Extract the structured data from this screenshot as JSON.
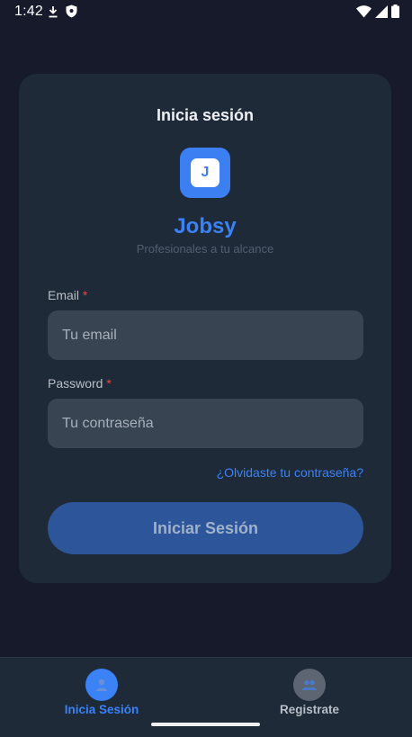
{
  "status_bar": {
    "time": "1:42",
    "icons": [
      "download-icon",
      "shield-icon",
      "wifi-icon",
      "signal-icon",
      "battery-icon"
    ]
  },
  "login_card": {
    "title": "Inicia sesión",
    "logo_letter": "J",
    "brand_name": "Jobsy",
    "tagline": "Profesionales a tu alcance",
    "email": {
      "label": "Email",
      "required_mark": "*",
      "placeholder": "Tu email",
      "value": ""
    },
    "password": {
      "label": "Password",
      "required_mark": "*",
      "placeholder": "Tu contraseña",
      "value": ""
    },
    "forgot_password": "¿Olvidaste tu contraseña?",
    "submit_label": "Iniciar Sesión"
  },
  "bottom_nav": {
    "items": [
      {
        "label": "Inicia Sesión",
        "icon": "user-icon",
        "active": true
      },
      {
        "label": "Registrate",
        "icon": "users-icon",
        "active": false
      }
    ]
  },
  "colors": {
    "accent": "#3b82f6",
    "background": "#161a2b",
    "card": "#1e2a38",
    "required": "#ef4444"
  }
}
